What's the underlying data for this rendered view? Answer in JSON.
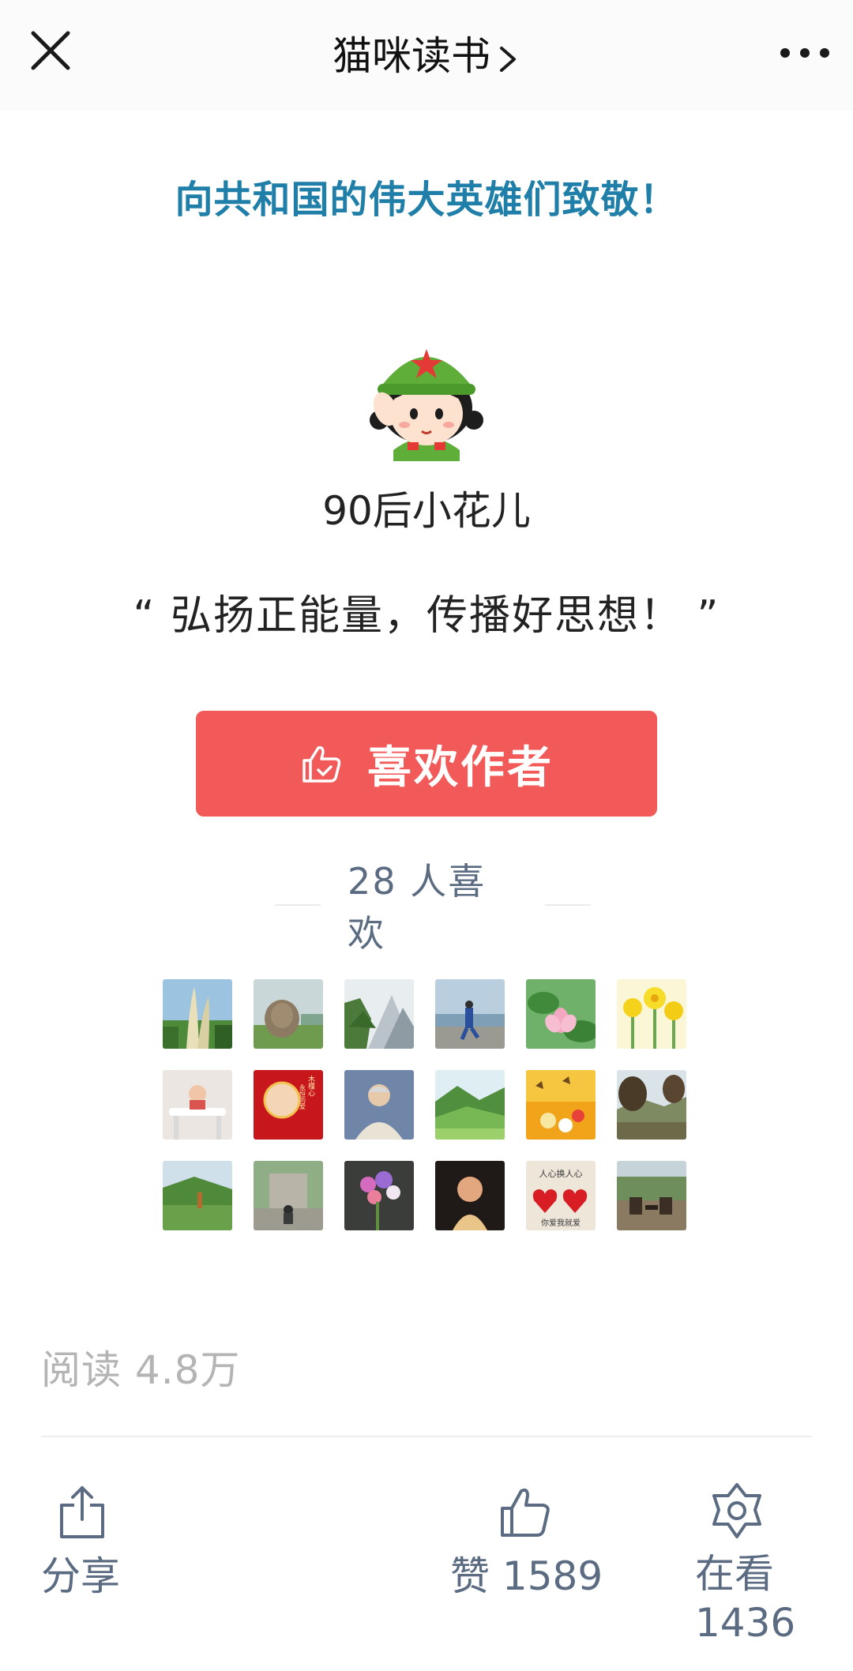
{
  "nav": {
    "title": "猫咪读书",
    "close_icon": "close-icon",
    "more_icon": "more-icon"
  },
  "article": {
    "headline": "向共和国的伟大英雄们致敬！"
  },
  "author": {
    "name": "90后小花儿",
    "slogan": "“ 弘扬正能量，传播好思想！ ”",
    "like_button_label": "喜欢作者",
    "likes_count": "28 人喜欢"
  },
  "fans": [
    "fan-avatar-1",
    "fan-avatar-2",
    "fan-avatar-3",
    "fan-avatar-4",
    "fan-avatar-5",
    "fan-avatar-6",
    "fan-avatar-7",
    "fan-avatar-8",
    "fan-avatar-9",
    "fan-avatar-10",
    "fan-avatar-11",
    "fan-avatar-12",
    "fan-avatar-13",
    "fan-avatar-14",
    "fan-avatar-15",
    "fan-avatar-16",
    "fan-avatar-17",
    "fan-avatar-18"
  ],
  "fan_captions": {
    "fan8_line1": "木槿心",
    "fan8_line2": "永恒的爱",
    "fan17_top": "人心换人心",
    "fan17_bottom": "你爱我就爱"
  },
  "stats": {
    "read_label": "阅读 4.8万"
  },
  "actions": {
    "share_label": "分享",
    "zan_label": "赞 1589",
    "kan_label": "在看 1436"
  },
  "colors": {
    "headline": "#1f7fa8",
    "like_button": "#f25a5a",
    "muted_text": "#5b6b82",
    "read_text": "#b4b4b4"
  }
}
